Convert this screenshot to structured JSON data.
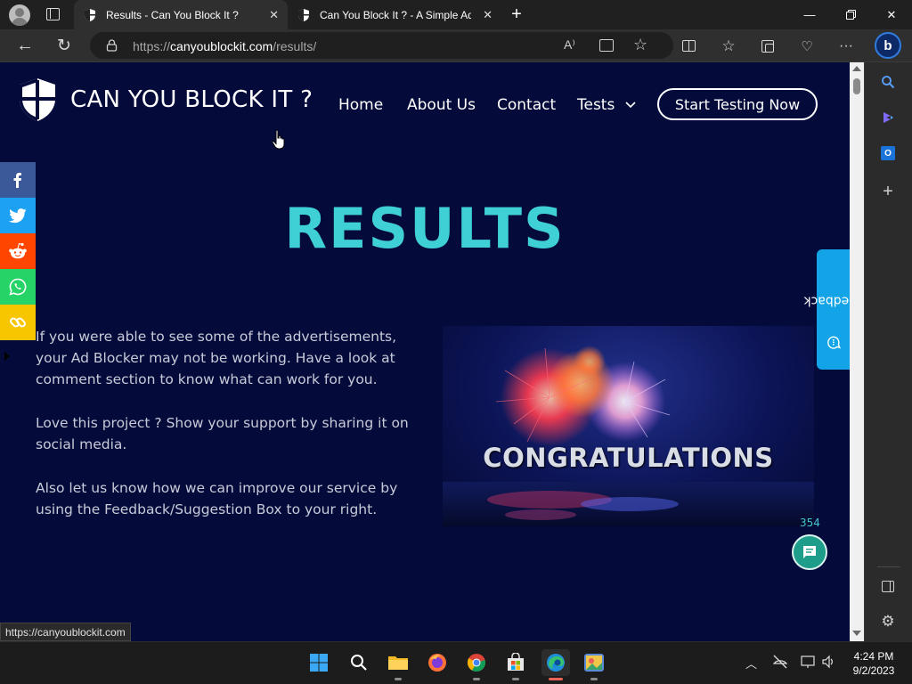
{
  "browser": {
    "tabs": [
      {
        "title": "Results - Can You Block It ?",
        "active": true
      },
      {
        "title": "Can You Block It ? - A Simple Ad",
        "active": false
      }
    ],
    "url_prefix": "https://",
    "url_domain": "canyoublockit.com",
    "url_path": "/results/"
  },
  "site": {
    "logo_text": "CAN YOU BLOCK IT ?",
    "nav": {
      "home": "Home",
      "about": "About Us",
      "contact": "Contact",
      "tests": "Tests",
      "cta": "Start Testing Now"
    },
    "heading": "RESULTS",
    "paragraphs": [
      "If you were able to see some of the advertisements, your Ad Blocker may not be working. Have a look at comment section to know what can work for you.",
      "Love this project ? Show your support by sharing it on social media.",
      "Also let us know how we can improve our service by using the Feedback/Suggestion Box to your right."
    ],
    "image_caption": "CONGRATULATIONS",
    "feedback_label": "Feedback",
    "chat_count": "354",
    "social_icons": [
      "facebook-icon",
      "twitter-icon",
      "reddit-icon",
      "whatsapp-icon",
      "copy-link-icon"
    ],
    "social_colors": [
      "#3b5998",
      "#1da1f2",
      "#ff4500",
      "#25d366",
      "#f7c600"
    ]
  },
  "status_bar": {
    "url": "https://canyoublockit.com"
  },
  "taskbar": {
    "time": "4:24 PM",
    "date": "9/2/2023"
  }
}
